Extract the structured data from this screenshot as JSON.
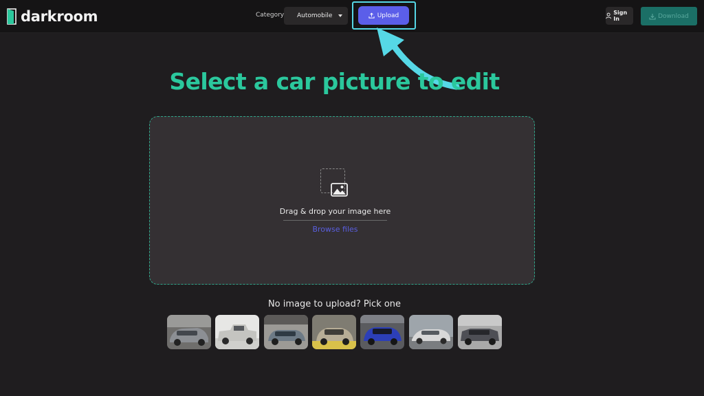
{
  "header": {
    "logo_text": "darkroom",
    "category_label": "Category:",
    "category_value": "Automobile",
    "upload_label": "Upload",
    "signin_label": "Sign In",
    "download_label": "Download"
  },
  "main": {
    "headline": "Select a car picture to edit",
    "dropzone": {
      "text": "Drag & drop your image here",
      "browse_label": "Browse files"
    },
    "samples": {
      "title": "No image to upload? Pick one",
      "items": [
        {
          "name": "sample-car-1",
          "color": "#8c8f94"
        },
        {
          "name": "sample-car-2",
          "color": "#c4c4c0"
        },
        {
          "name": "sample-car-3",
          "color": "#6d7a86"
        },
        {
          "name": "sample-car-4",
          "color": "#b7ad96"
        },
        {
          "name": "sample-car-5",
          "color": "#2c3fb8"
        },
        {
          "name": "sample-car-6",
          "color": "#d8d8d8"
        },
        {
          "name": "sample-car-7",
          "color": "#4e4f55"
        }
      ]
    }
  },
  "colors": {
    "accent": "#2bc89d",
    "primary": "#5b5ee9",
    "highlight": "#56d8e6"
  }
}
